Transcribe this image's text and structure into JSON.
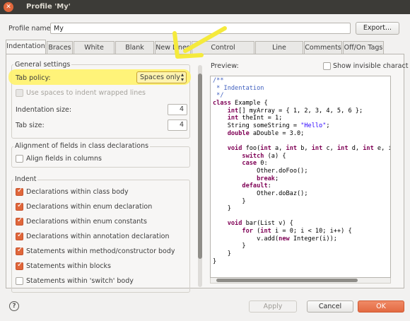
{
  "window": {
    "title": "Profile 'My'",
    "close_icon": "close-icon"
  },
  "profile": {
    "label": "Profile name:",
    "value": "My",
    "export_label": "Export..."
  },
  "tabs": [
    {
      "label": "Indentation",
      "active": true
    },
    {
      "label": "Braces"
    },
    {
      "label": "White Space"
    },
    {
      "label": "Blank Lines"
    },
    {
      "label": "New Lines"
    },
    {
      "label": "Control Statements"
    },
    {
      "label": "Line Wrapping"
    },
    {
      "label": "Comments"
    },
    {
      "label": "Off/On Tags"
    }
  ],
  "general": {
    "title": "General settings",
    "tab_policy_label": "Tab policy:",
    "tab_policy_value": "Spaces only",
    "spaces_wrapped_label": "Use spaces to indent wrapped lines",
    "indent_size_label": "Indentation size:",
    "indent_size_value": "4",
    "tab_size_label": "Tab size:",
    "tab_size_value": "4"
  },
  "alignment": {
    "title": "Alignment of fields in class declarations",
    "align_label": "Align fields in columns"
  },
  "indent": {
    "title": "Indent",
    "items": [
      {
        "label": "Declarations within class body",
        "checked": true
      },
      {
        "label": "Declarations within enum declaration",
        "checked": true
      },
      {
        "label": "Declarations within enum constants",
        "checked": true
      },
      {
        "label": "Declarations within annotation declaration",
        "checked": true
      },
      {
        "label": "Statements within method/constructor body",
        "checked": true
      },
      {
        "label": "Statements within blocks",
        "checked": true
      },
      {
        "label": "Statements within 'switch' body",
        "checked": false
      }
    ]
  },
  "preview": {
    "label": "Preview:",
    "show_invisible_label": "Show invisible charact",
    "code_lines": [
      "/**",
      " * Indentation",
      " */",
      "class Example {",
      "    int[] myArray = { 1, 2, 3, 4, 5, 6 };",
      "    int theInt = 1;",
      "    String someString = \"Hello\";",
      "    double aDouble = 3.0;",
      "",
      "    void foo(int a, int b, int c, int d, int e, in",
      "        switch (a) {",
      "        case 0:",
      "            Other.doFoo();",
      "            break;",
      "        default:",
      "            Other.doBaz();",
      "        }",
      "    }",
      "",
      "    void bar(List v) {",
      "        for (int i = 0; i < 10; i++) {",
      "            v.add(new Integer(i));",
      "        }",
      "    }",
      "}"
    ]
  },
  "footer": {
    "help_icon": "help-icon",
    "help_glyph": "?",
    "apply_label": "Apply",
    "cancel_label": "Cancel",
    "ok_label": "OK"
  },
  "colors": {
    "accent": "#e0673b",
    "highlight": "#fff36b",
    "annotation_arrow": "#f5ea3c"
  }
}
